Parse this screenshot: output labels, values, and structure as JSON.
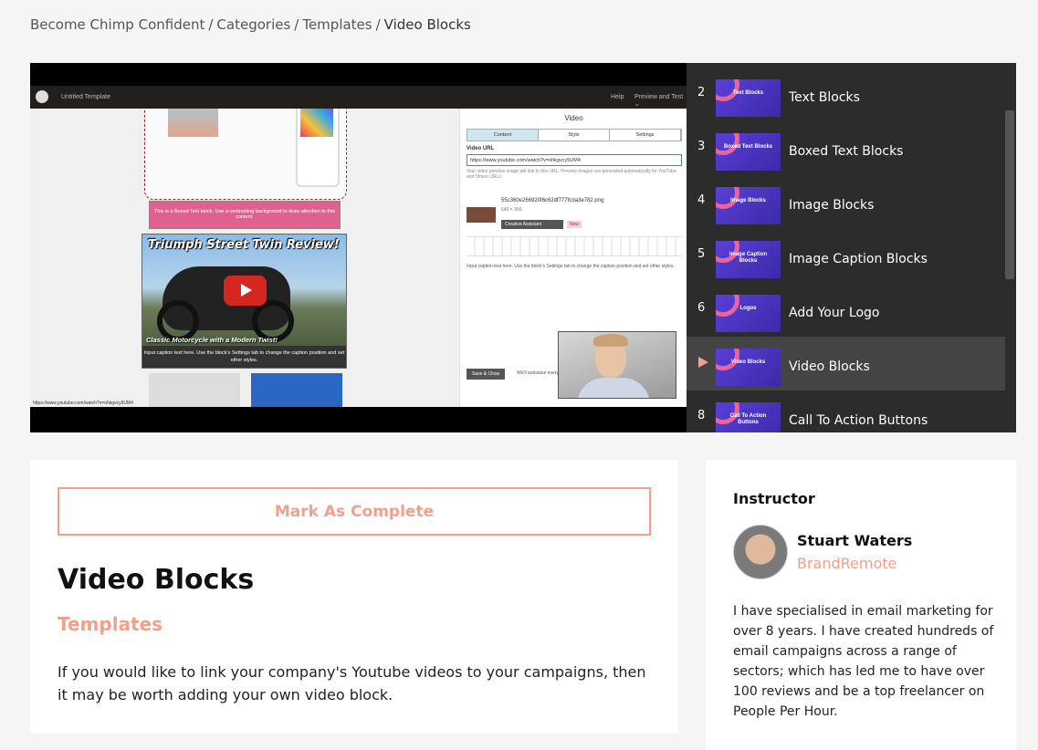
{
  "breadcrumb": {
    "items": [
      "Become Chimp Confident",
      "Categories",
      "Templates"
    ],
    "current": "Video Blocks",
    "separator": "/"
  },
  "video_frame": {
    "app_title": "Untitled Template",
    "help": "Help",
    "preview": "Preview and Test ⌄",
    "boxed_text": "This is a Boxed Text block. Use a contrasting background to draw attention to this content.",
    "thumb_title": "Triumph Street Twin Review!",
    "thumb_subtitle": "Classic Motorcycle with a Modern Twist!",
    "thumb_caption": "Input caption text here. Use the block's Settings tab to change the caption position and set other styles.",
    "panel_title": "Video",
    "tabs": [
      "Content",
      "Style",
      "Settings"
    ],
    "url_label": "Video URL",
    "url_value": "https://www.youtube.com/watch?v=ohkgvcy5UM4",
    "hint": "Your video preview image will link to this URL. Preview images are generated automatically for YouTube and Vimeo URLs.",
    "file_name": "55c360e266920f6c62df777fcda3e782.png",
    "file_dims": "640 × 360",
    "creative_assistant": "Creative Assistant",
    "new_badge": "New",
    "editor_text": "Input caption text here. Use the block's Settings tab to change the caption position and set other styles.",
    "save_close": "Save & Close",
    "autosave": "We'll autosave every",
    "status_url": "https://www.youtube.com/watch?v=ohkgvcy5UM4"
  },
  "playlist": [
    {
      "num": "2",
      "thumb": "Text Blocks",
      "label": "Text Blocks",
      "active": false
    },
    {
      "num": "3",
      "thumb": "Boxed Text Blocks",
      "label": "Boxed Text Blocks",
      "active": false
    },
    {
      "num": "4",
      "thumb": "Image Blocks",
      "label": "Image Blocks",
      "active": false
    },
    {
      "num": "5",
      "thumb": "Image Caption Blocks",
      "label": "Image Caption Blocks",
      "active": false
    },
    {
      "num": "6",
      "thumb": "Logos",
      "label": "Add Your Logo",
      "active": false
    },
    {
      "num": "",
      "thumb": "Video Blocks",
      "label": "Video Blocks",
      "active": true
    },
    {
      "num": "8",
      "thumb": "Call To Action Buttons",
      "label": "Call To Action Buttons",
      "active": false
    }
  ],
  "lesson": {
    "mark_complete": "Mark As Complete",
    "title": "Video Blocks",
    "category": "Templates",
    "description": "If you would like to link your company's Youtube videos to your campaigns, then it may be worth adding your own video block."
  },
  "instructor": {
    "heading": "Instructor",
    "name": "Stuart Waters",
    "company": "BrandRemote",
    "bio": "I have specialised in email marketing for over 8 years. I have created hundreds of email campaigns across a range of sectors; which has led me to have over 100 reviews and be a top freelancer on People Per Hour."
  },
  "colors": {
    "accent": "#f2a08c",
    "sidebar_bg": "#2c2c2c",
    "sidebar_active": "#444444",
    "page_bg": "#f5f5f5"
  },
  "icons": {
    "now_playing": "play-arrow-icon",
    "video_play": "youtube-play-icon"
  }
}
